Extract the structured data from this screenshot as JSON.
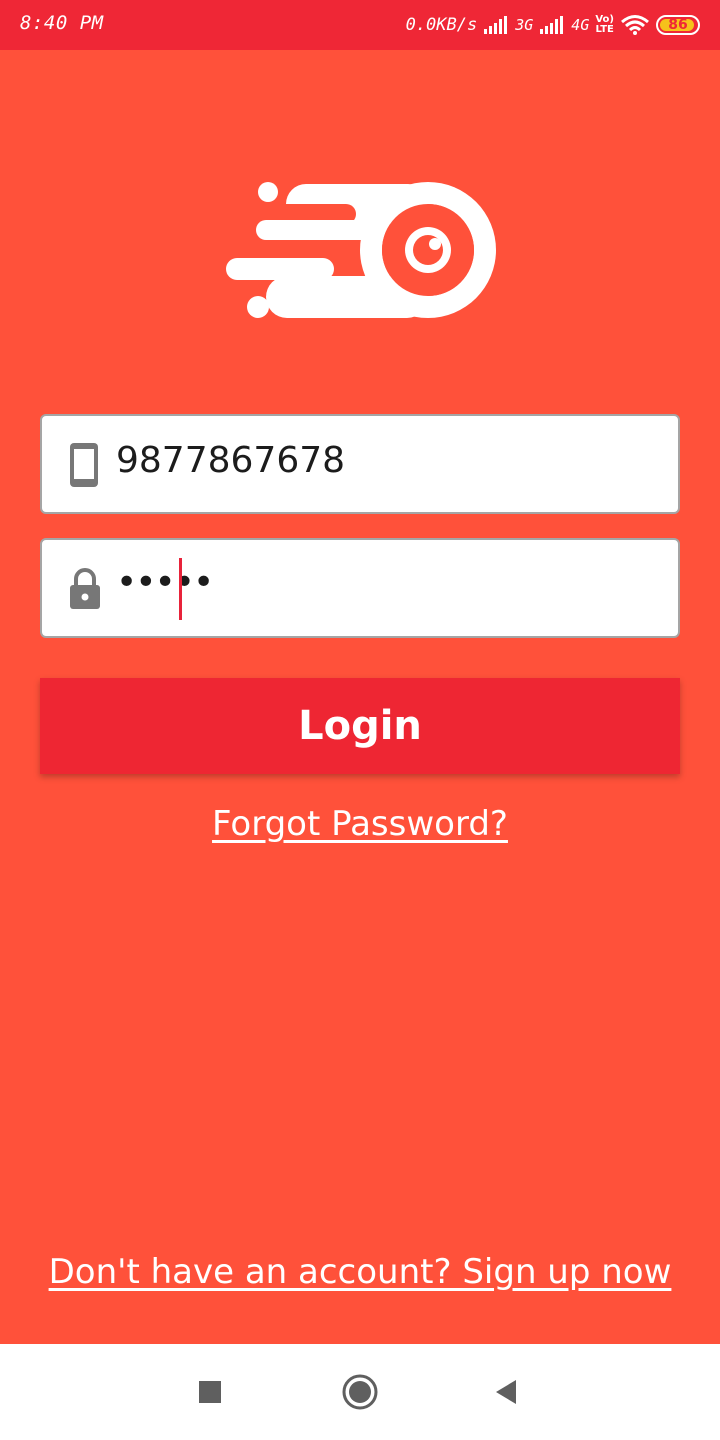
{
  "status_bar": {
    "time": "8:40 PM",
    "network_speed": "0.0KB/s",
    "network_1": "3G",
    "network_2": "4G",
    "volte_top": "Vo)",
    "volte_bottom": "LTE",
    "battery_level": "86",
    "icons": [
      "signal-icon",
      "wifi-icon",
      "battery-icon"
    ]
  },
  "logo": {
    "icon": "speed-logo-icon",
    "colors": {
      "foreground": "#ffffff",
      "background": "#ff513a"
    }
  },
  "login_form": {
    "phone_field": {
      "icon": "phone-icon",
      "value": "9877867678"
    },
    "password_field": {
      "icon": "lock-icon",
      "value": "•••••"
    },
    "login_label": "Login",
    "forgot_password_label": "Forgot Password?"
  },
  "signup_label": "Don't have an account? Sign up now",
  "navigation_bar": {
    "icons": [
      "recent-apps-icon",
      "home-icon",
      "back-icon"
    ]
  },
  "colors": {
    "background": "#ff513a",
    "status_bar": "#ef2736",
    "button": "#ee2633",
    "text": "#ffffff"
  }
}
